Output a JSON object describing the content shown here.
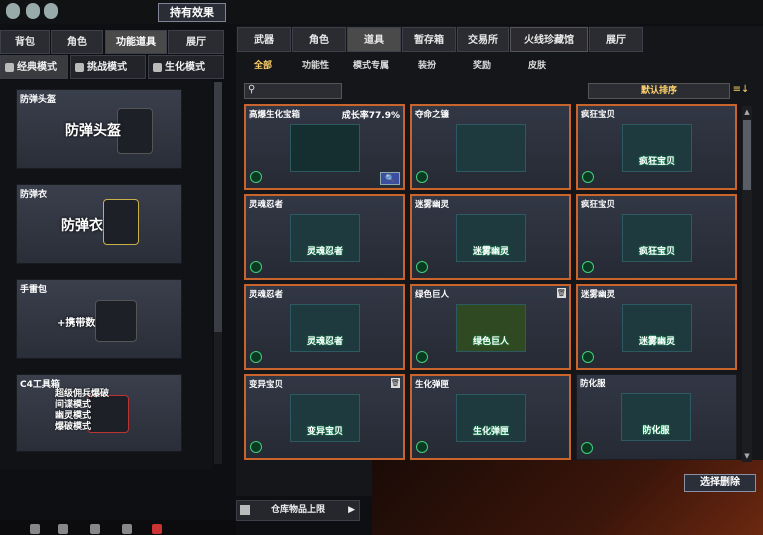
{
  "topbar": {
    "effect_button": "持有效果"
  },
  "left_tabs": [
    "背包",
    "角色",
    "功能道具",
    "展厅"
  ],
  "mode_tabs": [
    "经典模式",
    "挑战模式",
    "生化模式"
  ],
  "left_items": [
    {
      "name": "防弹头盔",
      "center": "防弹头盔"
    },
    {
      "name": "防弹衣",
      "center": "防弹衣"
    },
    {
      "name": "手雷包",
      "center": "+携带数"
    },
    {
      "name": "C4工具箱",
      "lines": [
        "超级佣兵爆破",
        "间谍模式",
        "幽灵模式",
        "爆破模式"
      ]
    }
  ],
  "right_tabs": [
    "武器",
    "角色",
    "道具",
    "暂存箱",
    "交易所",
    "火线珍藏馆",
    "展厅"
  ],
  "sub_tabs": [
    "全部",
    "功能性",
    "模式专属",
    "装扮",
    "奖励",
    "皮肤"
  ],
  "search": {
    "placeholder": ""
  },
  "sort_label": "默认排序",
  "items": [
    {
      "name": "高爆生化宝箱",
      "rate": "成长率77.9%",
      "img_label": ""
    },
    {
      "name": "夺命之镰",
      "img_label": ""
    },
    {
      "name": "疯狂宝贝",
      "img_label": "疯狂宝贝"
    },
    {
      "name": "灵魂忍者",
      "img_label": "灵魂忍者"
    },
    {
      "name": "迷雾幽灵",
      "img_label": "迷雾幽灵"
    },
    {
      "name": "疯狂宝贝",
      "img_label": "疯狂宝贝"
    },
    {
      "name": "灵魂忍者",
      "img_label": "灵魂忍者"
    },
    {
      "name": "绿色巨人",
      "img_label": "绿色巨人"
    },
    {
      "name": "迷雾幽灵",
      "img_label": "迷雾幽灵"
    },
    {
      "name": "变异宝贝",
      "img_label": "变异宝贝"
    },
    {
      "name": "生化弹匣",
      "img_label": "生化弹匣"
    },
    {
      "name": "防化服",
      "img_label": "防化服"
    }
  ],
  "delete_button": "选择删除",
  "storage_limit": "仓库物品上限",
  "colors": {
    "selected_border": "#c8642c",
    "accent_text": "#ffd36b"
  }
}
